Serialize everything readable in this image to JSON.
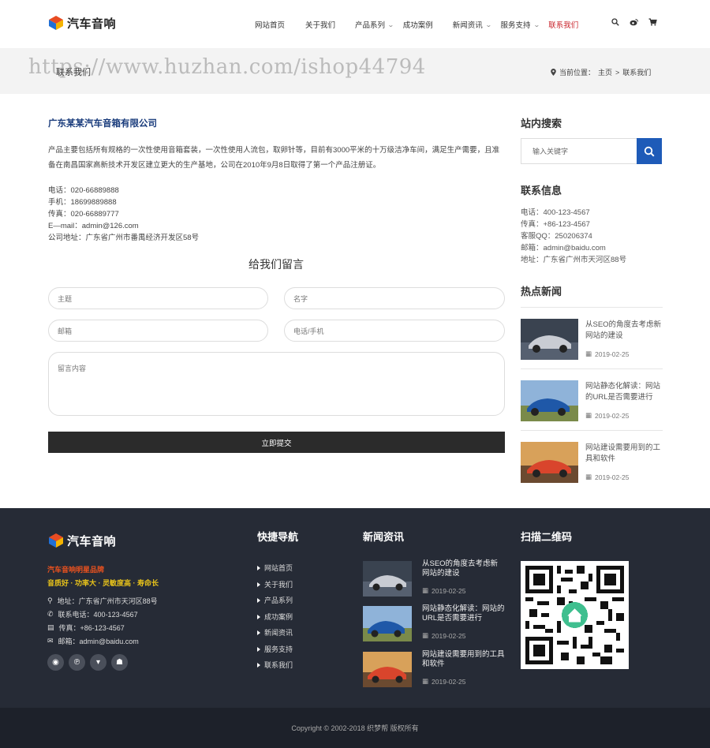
{
  "header": {
    "logo_text": "汽车音响",
    "nav": [
      {
        "label": "网站首页",
        "dropdown": false,
        "active": false
      },
      {
        "label": "关于我们",
        "dropdown": false,
        "active": false
      },
      {
        "label": "产品系列",
        "dropdown": true,
        "active": false
      },
      {
        "label": "成功案例",
        "dropdown": false,
        "active": false
      },
      {
        "label": "新闻资讯",
        "dropdown": true,
        "active": false
      },
      {
        "label": "服务支持",
        "dropdown": true,
        "active": false
      },
      {
        "label": "联系我们",
        "dropdown": false,
        "active": true
      }
    ],
    "icons": [
      "search-icon",
      "weibo-icon",
      "cart-icon"
    ]
  },
  "banner": {
    "title": "联系我们",
    "watermark": "https://www.huzhan.com/ishop44794",
    "breadcrumb_prefix": "当前位置：",
    "breadcrumb_home": "主页",
    "breadcrumb_sep": ">",
    "breadcrumb_current": "联系我们"
  },
  "main": {
    "company": "广东某某汽车音箱有限公司",
    "intro": "产品主要包括所有规格的一次性使用音箱套装，一次性使用人流包，取卵针等，目前有3000平米的十万级洁净车间，满足生产需要，且准备在南昌国家高新技术开发区建立更大的生产基地，公司在2010年9月8日取得了第一个产品注册证。",
    "contacts": [
      "电话：020-66889888",
      "手机：18699889888",
      "传真：020-66889777",
      "E—mail：admin@126.com",
      "公司地址：广东省广州市番禺经济开发区58号"
    ],
    "form": {
      "title": "给我们留言",
      "subject_placeholder": "主题",
      "name_placeholder": "名字",
      "email_placeholder": "邮箱",
      "phone_placeholder": "电话/手机",
      "message_placeholder": "留言内容",
      "submit_label": "立即提交"
    }
  },
  "sidebar": {
    "search_heading": "站内搜索",
    "search_placeholder": "输入关键字",
    "contact_heading": "联系信息",
    "contact": [
      "电话：400-123-4567",
      "传真：+86-123-4567",
      "客服QQ：250206374",
      "邮箱：admin@baidu.com",
      "地址：广东省广州市天河区88号"
    ],
    "news_heading": "热点新闻",
    "news": [
      {
        "title": "从SEO的角度去考虑新网站的建设",
        "date": "2019-02-25"
      },
      {
        "title": "网站静态化解读：网站的URL是否需要进行",
        "date": "2019-02-25"
      },
      {
        "title": "网站建设需要用到的工具和软件",
        "date": "2019-02-25"
      }
    ]
  },
  "footer": {
    "logo_text": "汽车音响",
    "slogan1": "汽车音响明星品牌",
    "slogan2": "音质好 · 功率大 · 灵敏度高 · 寿命长",
    "contact": [
      {
        "icon": "location-icon",
        "text": "地址：广东省广州市天河区88号"
      },
      {
        "icon": "phone-icon",
        "text": "联系电话：400-123-4567"
      },
      {
        "icon": "fax-icon",
        "text": "传真：+86-123-4567"
      },
      {
        "icon": "mail-icon",
        "text": "邮箱：admin@baidu.com"
      }
    ],
    "social": [
      "weibo-icon",
      "pinterest-icon",
      "cart-icon",
      "qq-icon"
    ],
    "quicknav_heading": "快捷导航",
    "quicknav": [
      "网站首页",
      "关于我们",
      "产品系列",
      "成功案例",
      "新闻资讯",
      "服务支持",
      "联系我们"
    ],
    "news_heading": "新闻资讯",
    "news": [
      {
        "title": "从SEO的角度去考虑新网站的建设",
        "date": "2019-02-25"
      },
      {
        "title": "网站静态化解读：网站的URL是否需要进行",
        "date": "2019-02-25"
      },
      {
        "title": "网站建设需要用到的工具和软件",
        "date": "2019-02-25"
      }
    ],
    "qr_heading": "扫描二维码",
    "copyright": "Copyright © 2002-2018 织梦帮 版权所有"
  },
  "colors": {
    "accent_red": "#c9242b",
    "brand_blue": "#1a3c7c",
    "search_blue": "#1e5bb8",
    "footer_bg": "#262b36",
    "copyright_bg": "#1d212a"
  }
}
